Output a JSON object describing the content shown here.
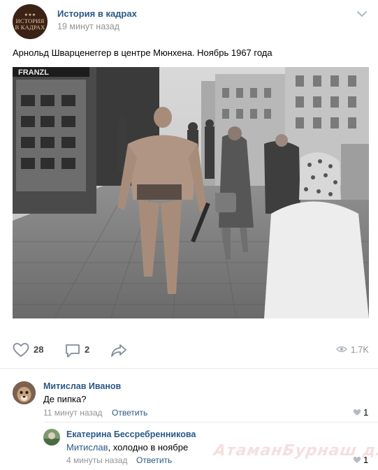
{
  "post": {
    "page_name": "История в кадрах",
    "logo_lines": [
      "ИСТОРИЯ",
      "В КАДРАХ"
    ],
    "time": "19 минут назад",
    "text": "Арнольд Шварценеггер в центре Мюнхена. Ноябрь 1967 года",
    "photo_sign": "FRANZL"
  },
  "actions": {
    "likes": "28",
    "comments": "2",
    "views": "1.7K"
  },
  "comments": [
    {
      "author": "Митислав Иванов",
      "text": "Де пипка?",
      "time": "11 минут назад",
      "reply_label": "Ответить",
      "likes": "1"
    },
    {
      "author": "Екатерина Бессребренникова",
      "mention": "Митислав",
      "text": ", холодно в ноябре",
      "time": "4 минуты назад",
      "reply_label": "Ответить",
      "likes": "1"
    }
  ],
  "watermark": "АтаманБурнаш для ЯП"
}
